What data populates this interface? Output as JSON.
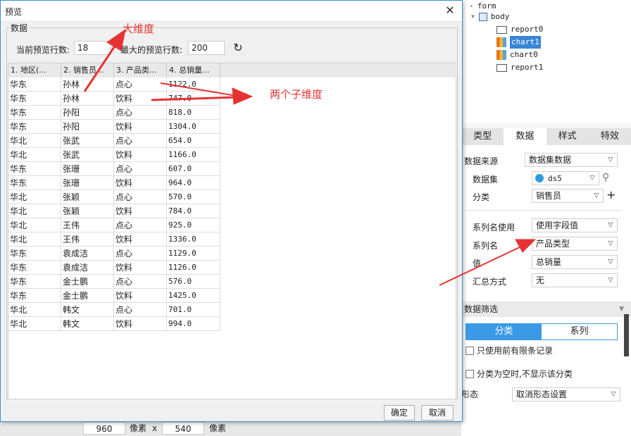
{
  "dialog": {
    "title": "预览",
    "close_icon": "close-icon",
    "group_label": "数据",
    "current_rows_label": "当前预览行数:",
    "current_rows_value": "18",
    "max_rows_label": "最大的预览行数:",
    "max_rows_value": "200",
    "refresh_icon": "refresh-icon",
    "columns": [
      "1. 地区(...",
      "2. 销售员...",
      "3. 产品类...",
      "4. 总销量..."
    ],
    "rows": [
      [
        "华东",
        "孙林",
        "点心",
        "1122.0"
      ],
      [
        "华东",
        "孙林",
        "饮料",
        "747.0"
      ],
      [
        "华东",
        "孙阳",
        "点心",
        "818.0"
      ],
      [
        "华东",
        "孙阳",
        "饮料",
        "1304.0"
      ],
      [
        "华北",
        "张武",
        "点心",
        "654.0"
      ],
      [
        "华北",
        "张武",
        "饮料",
        "1166.0"
      ],
      [
        "华东",
        "张珊",
        "点心",
        "607.0"
      ],
      [
        "华东",
        "张珊",
        "饮料",
        "964.0"
      ],
      [
        "华北",
        "张颖",
        "点心",
        "570.0"
      ],
      [
        "华北",
        "张颖",
        "饮料",
        "784.0"
      ],
      [
        "华北",
        "王伟",
        "点心",
        "925.0"
      ],
      [
        "华北",
        "王伟",
        "饮料",
        "1336.0"
      ],
      [
        "华东",
        "袁成洁",
        "点心",
        "1129.0"
      ],
      [
        "华东",
        "袁成洁",
        "饮料",
        "1126.0"
      ],
      [
        "华东",
        "金士鹏",
        "点心",
        "576.0"
      ],
      [
        "华东",
        "金士鹏",
        "饮料",
        "1425.0"
      ],
      [
        "华北",
        "韩文",
        "点心",
        "701.0"
      ],
      [
        "华北",
        "韩文",
        "饮料",
        "994.0"
      ]
    ],
    "ok_label": "确定",
    "cancel_label": "取消"
  },
  "annotations": {
    "big_dimension": "大维度",
    "two_sub_dimensions": "两个子维度",
    "color": "#e53333"
  },
  "tree": {
    "items": [
      {
        "label": "form",
        "kind": "form"
      },
      {
        "label": "body",
        "kind": "body"
      },
      {
        "label": "report0",
        "kind": "report"
      },
      {
        "label": "chart1",
        "kind": "chart",
        "selected": true
      },
      {
        "label": "chart0",
        "kind": "chart"
      },
      {
        "label": "report1",
        "kind": "report"
      }
    ]
  },
  "panel": {
    "tabs": [
      "类型",
      "数据",
      "样式",
      "特效"
    ],
    "active_tab": "数据",
    "data_source_label": "数据来源",
    "data_source_value": "数据集数据",
    "dataset_label": "数据集",
    "dataset_value": "ds5",
    "category_label": "分类",
    "category_value": "销售员",
    "series_name_use_label": "系列名使用",
    "series_name_use_value": "使用字段值",
    "series_name_label": "系列名",
    "series_name_value": "产品类型",
    "value_label": "值",
    "value_value": "总销量",
    "summary_label": "汇总方式",
    "summary_value": "无",
    "filter_header": "数据筛选",
    "seg_category": "分类",
    "seg_series": "系列",
    "limit_records_label": "只使用前有限条记录",
    "hide_empty_label": "分类为空时,不显示该分类",
    "shape_label": "形态",
    "shape_value": "取消形态设置"
  },
  "status": {
    "width_value": "960",
    "unit_label_1": "像素",
    "times": "x",
    "height_value": "540",
    "unit_label_2": "像素"
  }
}
